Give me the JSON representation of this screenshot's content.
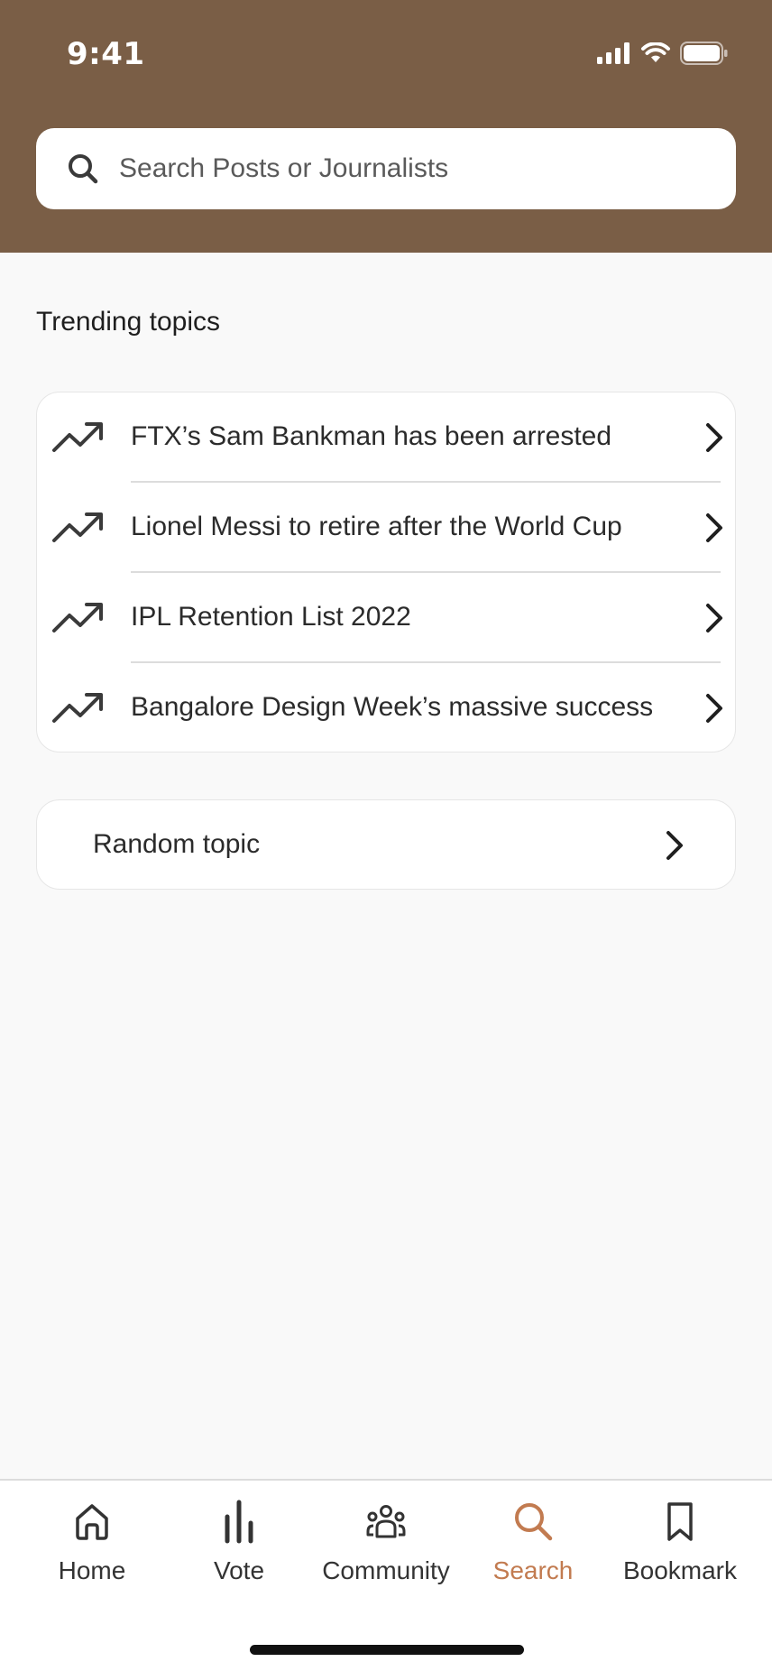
{
  "status_bar": {
    "time": "9:41"
  },
  "search": {
    "placeholder": "Search Posts or Journalists"
  },
  "trending": {
    "title": "Trending topics",
    "items": [
      {
        "label": "FTX’s Sam Bankman has been arrested"
      },
      {
        "label": "Lionel Messi to retire after the World Cup"
      },
      {
        "label": "IPL Retention List 2022"
      },
      {
        "label": "Bangalore Design Week’s massive success"
      }
    ]
  },
  "random_topic": {
    "label": "Random topic"
  },
  "tabbar": {
    "active": "Search",
    "tabs": [
      {
        "label": "Home",
        "icon": "home-icon"
      },
      {
        "label": "Vote",
        "icon": "vote-bars-icon"
      },
      {
        "label": "Community",
        "icon": "community-icon"
      },
      {
        "label": "Search",
        "icon": "search-icon"
      },
      {
        "label": "Bookmark",
        "icon": "bookmark-icon"
      }
    ]
  },
  "colors": {
    "header_bg": "#7a5e46",
    "accent": "#c27b50",
    "page_bg": "#f9f9f9"
  }
}
